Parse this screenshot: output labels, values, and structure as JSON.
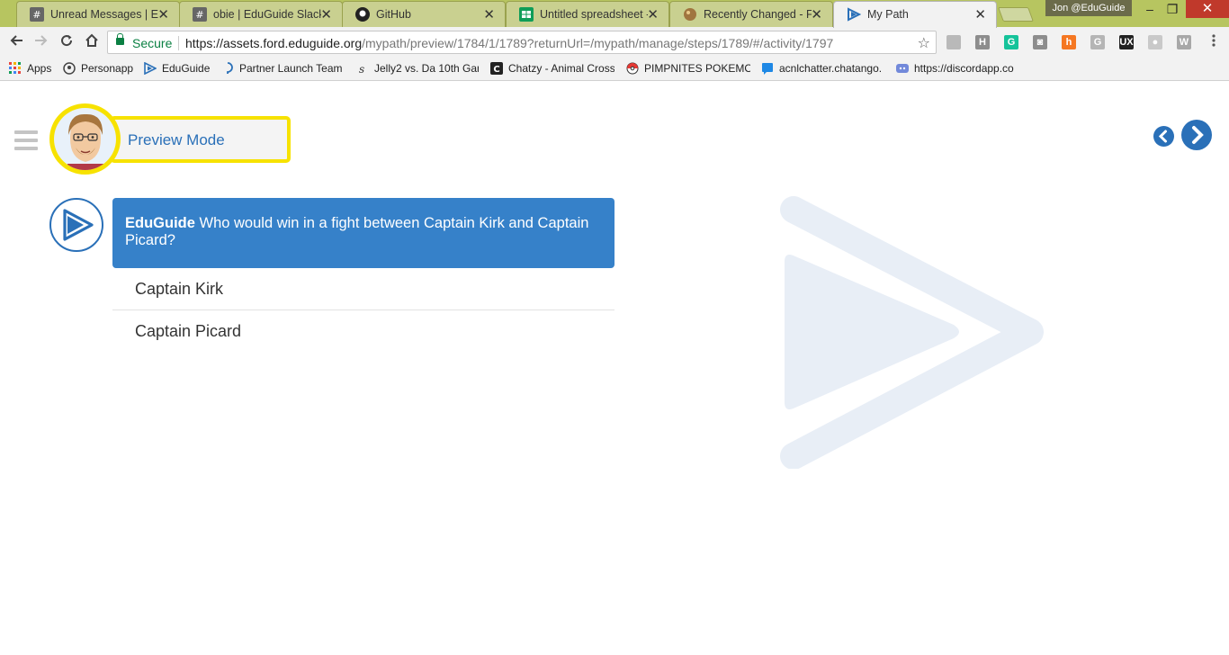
{
  "tabs": [
    {
      "title": "Unread Messages | Edu",
      "favicon": "slack-hash-icon",
      "active": false
    },
    {
      "title": "obie | EduGuide Slack",
      "favicon": "slack-hash-icon",
      "active": false
    },
    {
      "title": "GitHub",
      "favicon": "github-icon",
      "active": false
    },
    {
      "title": "Untitled spreadsheet -",
      "favicon": "sheets-icon",
      "active": false
    },
    {
      "title": "Recently Changed - Fo",
      "favicon": "app-icon",
      "active": false
    },
    {
      "title": "My Path",
      "favicon": "eduguide-icon",
      "active": true
    }
  ],
  "tab_close_glyph": "✕",
  "profile_name": "Jon @EduGuide",
  "window": {
    "minimize": "–",
    "maximize": "❐",
    "close": "✕"
  },
  "omnibox": {
    "secure_label": "Secure",
    "url_host": "https://assets.ford.eduguide.org",
    "url_path": "/mypath/preview/1784/1/1789?returnUrl=/mypath/manage/steps/1789/#/activity/1797"
  },
  "extensions": [
    {
      "name": "globe-ext-icon",
      "label": "",
      "color": "#b9b9b9"
    },
    {
      "name": "h-ext-icon",
      "label": "H",
      "color": "#8d8d8d"
    },
    {
      "name": "grammarly-ext-icon",
      "label": "G",
      "color": "#15c39a"
    },
    {
      "name": "camera-ext-icon",
      "label": "◙",
      "color": "#8d8d8d"
    },
    {
      "name": "hubspot-ext-icon",
      "label": "h",
      "color": "#f57722"
    },
    {
      "name": "g-ext-icon",
      "label": "G",
      "color": "#b5b5b5"
    },
    {
      "name": "ux-ext-icon",
      "label": "UX",
      "color": "#222222"
    },
    {
      "name": "circle-ext-icon",
      "label": "●",
      "color": "#c9c9c9"
    },
    {
      "name": "w-ext-icon",
      "label": "W",
      "color": "#a8a8a8"
    }
  ],
  "bookmarks": [
    {
      "label": "Apps",
      "icon": "apps-grid-icon"
    },
    {
      "label": "Personapp",
      "icon": "personapp-icon"
    },
    {
      "label": "EduGuide",
      "icon": "eduguide-icon"
    },
    {
      "label": "Partner Launch Team",
      "icon": "pin-icon"
    },
    {
      "label": "Jelly2 vs. Da 10th Gan",
      "icon": "s-icon"
    },
    {
      "label": "Chatzy - Animal Cross",
      "icon": "chatzy-icon"
    },
    {
      "label": "PIMPNITES POKEMON",
      "icon": "pokeball-icon"
    },
    {
      "label": "acnlchatter.chatango.",
      "icon": "chatango-icon"
    },
    {
      "label": "https://discordapp.co",
      "icon": "discord-icon"
    }
  ],
  "page": {
    "preview_label": "Preview Mode",
    "question_brand": "EduGuide",
    "question_text": " Who would win in a fight between Captain Kirk and Captain Picard?",
    "answers": [
      "Captain Kirk",
      "Captain Picard"
    ]
  },
  "colors": {
    "tabstrip": "#b7c560",
    "accent_blue": "#3681c9",
    "highlight_yellow": "#f7e200",
    "watermark": "#e8eef6"
  }
}
